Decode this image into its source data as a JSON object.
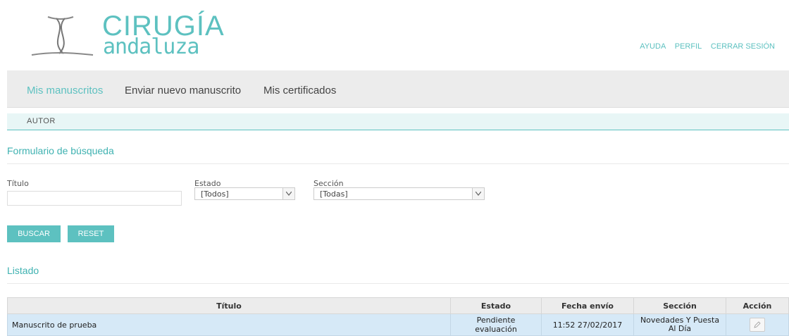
{
  "header": {
    "logo_line1": "CIRUGÍA",
    "logo_line2": "andaluza",
    "links": [
      "AYUDA",
      "PERFIL",
      "CERRAR SESIÓN"
    ]
  },
  "nav": {
    "items": [
      "Mis manuscritos",
      "Enviar nuevo manuscrito",
      "Mis certificados"
    ],
    "active": 0
  },
  "subbar": {
    "label": "AUTOR"
  },
  "search_form": {
    "title": "Formulario de búsqueda",
    "titulo_label": "Título",
    "titulo_value": "",
    "estado_label": "Estado",
    "estado_value": "[Todos]",
    "seccion_label": "Sección",
    "seccion_value": "[Todas]",
    "buscar_label": "BUSCAR",
    "reset_label": "RESET"
  },
  "listado": {
    "title": "Listado",
    "columns": [
      "Título",
      "Estado",
      "Fecha envío",
      "Sección",
      "Acción"
    ],
    "rows": [
      {
        "titulo": "Manuscrito de prueba",
        "estado": "Pendiente evaluación",
        "fecha": "11:52 27/02/2017",
        "seccion": "Novedades Y Puesta Al Día"
      }
    ]
  },
  "colors": {
    "accent": "#5dc1c0",
    "nav_bg": "#ececec",
    "row_bg": "#d6e9f7"
  },
  "icons": {
    "edit": "pencil-icon",
    "logo": "intertwined-rope-logo",
    "dropdown": "chevron-down-icon"
  }
}
